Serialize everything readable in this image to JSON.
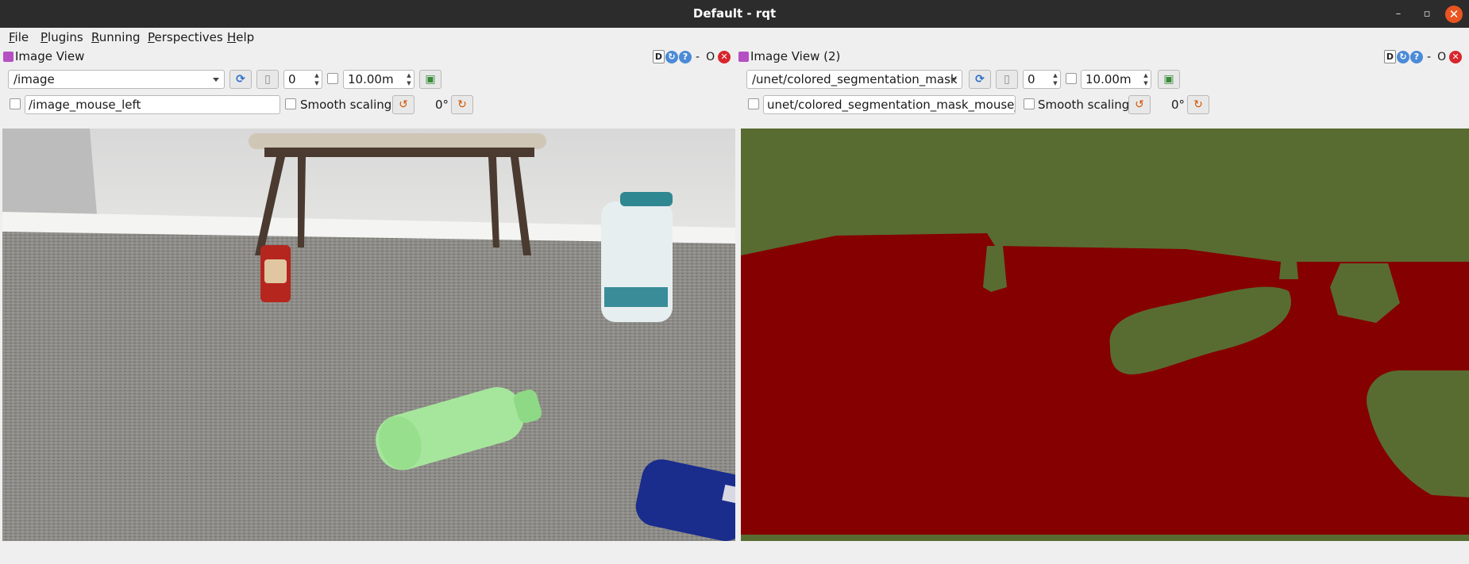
{
  "window": {
    "title": "Default - rqt",
    "minimize": "–",
    "maximize": "▫",
    "close": "✕"
  },
  "menu": [
    {
      "label": "File",
      "u": "F",
      "rest": "ile"
    },
    {
      "label": "Plugins",
      "u": "P",
      "rest": "lugins"
    },
    {
      "label": "Running",
      "u": "R",
      "rest": "unning"
    },
    {
      "label": "Perspectives",
      "u": "P",
      "rest": "erspectives"
    },
    {
      "label": "Help",
      "u": "H",
      "rest": "elp"
    }
  ],
  "panel1": {
    "title": "Image View",
    "dock_buttons": {
      "d": "D",
      "reload": "↻",
      "help": "?",
      "minimize": "-",
      "float": "O",
      "close": "✕"
    },
    "topic": "/image",
    "spin_value": "0",
    "max_value": "10.00m",
    "mouse_topic": "/image_mouse_left",
    "smooth_scaling_label": "Smooth scaling",
    "rotation": "0°"
  },
  "panel2": {
    "title": "Image View (2)",
    "dock_buttons": {
      "d": "D",
      "reload": "↻",
      "help": "?",
      "minimize": "-",
      "float": "O",
      "close": "✕"
    },
    "topic": "/unet/colored_segmentation_mask",
    "spin_value": "0",
    "max_value": "10.00m",
    "mouse_topic": "unet/colored_segmentation_mask_mouse_left",
    "smooth_scaling_label": "Smooth scaling",
    "rotation": "0°"
  },
  "colors": {
    "segmentation_background": "#586c31",
    "segmentation_floor": "#850000",
    "titlebar": "#2c2c2c",
    "close_button": "#e95420"
  }
}
